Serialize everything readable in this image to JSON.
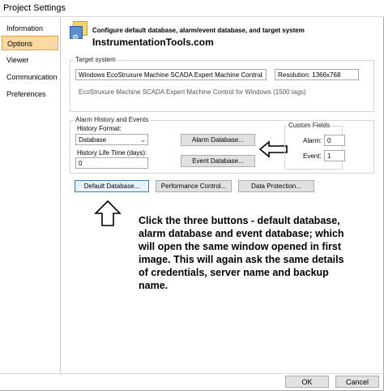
{
  "window": {
    "title": "Project Settings"
  },
  "sidebar": {
    "items": [
      {
        "label": "Information"
      },
      {
        "label": "Options"
      },
      {
        "label": "Viewer"
      },
      {
        "label": "Communication"
      },
      {
        "label": "Preferences"
      }
    ],
    "selected": "Options"
  },
  "header": {
    "text": "Configure default database, alarm/event database, and target system",
    "brand": "InstrumentationTools.com"
  },
  "target_system": {
    "group_title": "Target system",
    "selected_value": "Windows EcoStruxure Machine SCADA Expert Machine Control",
    "resolution_label": "Resolution: 1366x768",
    "description": "EcoStruxure Machine SCADA Expert Machine Control for Windows (1500 tags)"
  },
  "alarm_history": {
    "group_title": "Alarm History and Events",
    "history_format_label": "History Format:",
    "history_format_value": "Database",
    "history_life_label": "History Life Time (days):",
    "history_life_value": "0",
    "alarm_db_button": "Alarm Database...",
    "event_db_button": "Event Database..."
  },
  "custom_fields": {
    "group_title": "Custom Fields",
    "alarm_label": "Alarm:",
    "alarm_value": "0",
    "event_label": "Event:",
    "event_value": "1"
  },
  "buttons": {
    "default_db": "Default Database...",
    "performance": "Performance Control...",
    "data_protection": "Data Protection..."
  },
  "annotation": {
    "text": "Click the three buttons - default database, alarm database and event database; which will open the same window opened in first image. This will again ask the same details of credentials, server name and backup name."
  },
  "footer": {
    "ok": "OK",
    "cancel": "Cancel"
  },
  "colors": {
    "selected_nav": "#fcd9a1",
    "selected_nav_border": "#e4a54a",
    "default_button_border": "#3c7fb1"
  },
  "icons": [
    "database-settings-icon",
    "left-arrow-icon",
    "up-arrow-icon",
    "chevron-down-icon"
  ]
}
